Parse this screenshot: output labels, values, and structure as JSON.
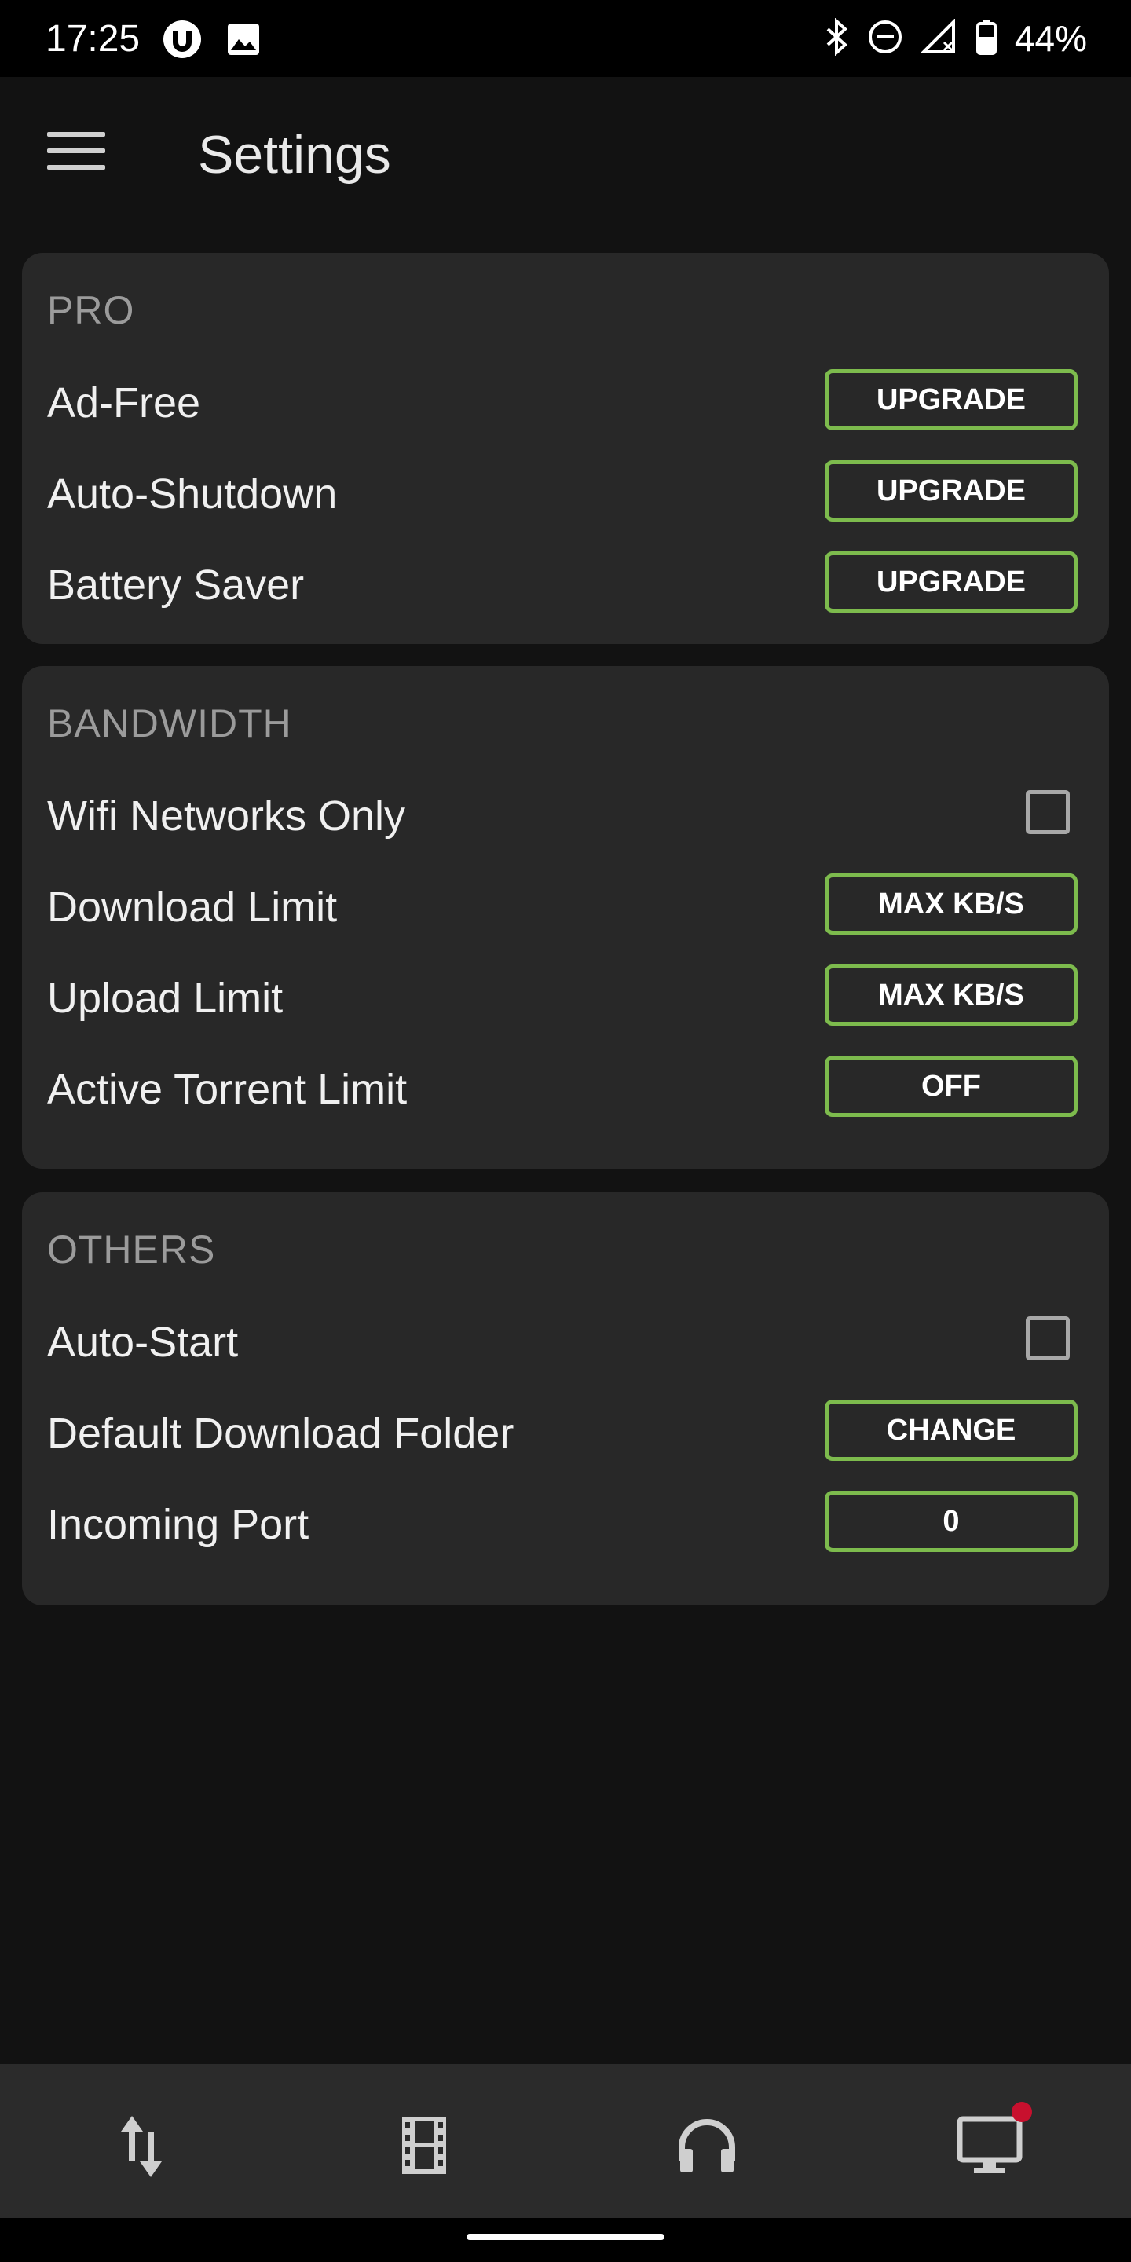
{
  "status_bar": {
    "time": "17:25",
    "battery": "44%",
    "icons": [
      "utorrent-icon",
      "image-icon",
      "bluetooth-icon",
      "dnd-icon",
      "signal-icon",
      "battery-icon"
    ]
  },
  "app_bar": {
    "title": "Settings"
  },
  "sections": {
    "pro": {
      "header": "PRO",
      "rows": [
        {
          "label": "Ad-Free",
          "button": "UPGRADE"
        },
        {
          "label": "Auto-Shutdown",
          "button": "UPGRADE"
        },
        {
          "label": "Battery Saver",
          "button": "UPGRADE"
        }
      ]
    },
    "bandwidth": {
      "header": "BANDWIDTH",
      "wifi": {
        "label": "Wifi Networks Only",
        "checked": false
      },
      "rows": [
        {
          "label": "Download Limit",
          "button": "MAX KB/S"
        },
        {
          "label": "Upload Limit",
          "button": "MAX KB/S"
        },
        {
          "label": "Active Torrent Limit",
          "button": "OFF"
        }
      ]
    },
    "others": {
      "header": "OTHERS",
      "autostart": {
        "label": "Auto-Start",
        "checked": false
      },
      "rows": [
        {
          "label": "Default Download Folder",
          "button": "CHANGE"
        },
        {
          "label": "Incoming Port",
          "button": "0"
        }
      ]
    }
  },
  "bottom_nav": {
    "items": [
      "transfers-icon",
      "video-icon",
      "audio-icon",
      "remote-icon"
    ]
  },
  "colors": {
    "accent": "#7dbb4d",
    "card": "#282828",
    "background": "#121212",
    "notification_dot": "#c8102e"
  }
}
